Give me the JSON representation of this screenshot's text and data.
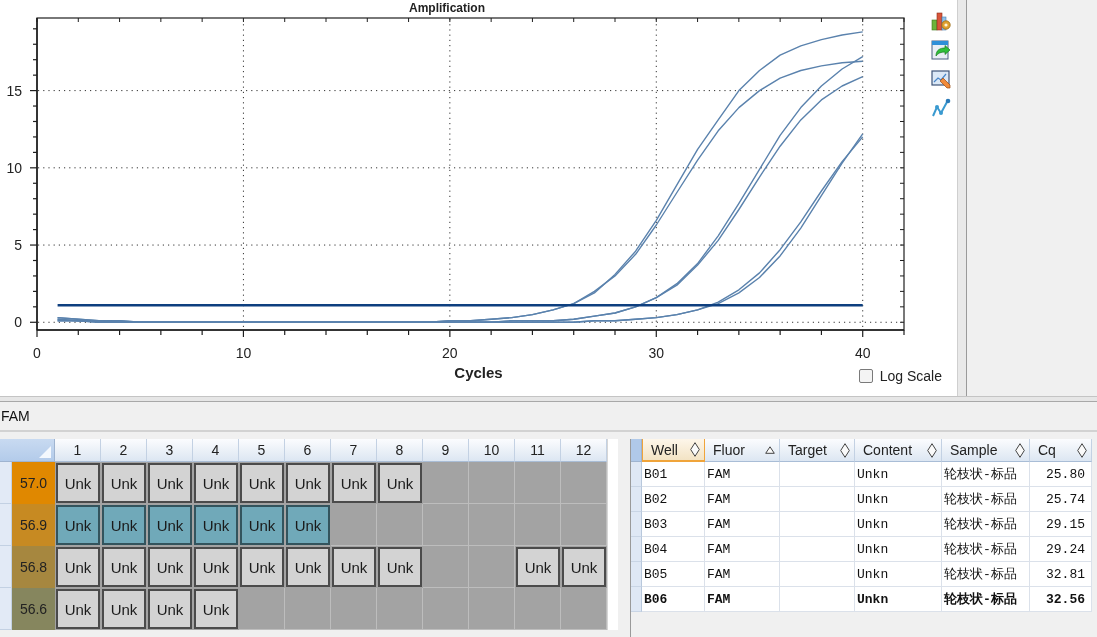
{
  "chart": {
    "chart_data": {
      "type": "line",
      "title": "Amplification",
      "xlabel": "Cycles",
      "x": [
        1,
        2,
        3,
        4,
        5,
        6,
        7,
        8,
        9,
        10,
        11,
        12,
        13,
        14,
        15,
        16,
        17,
        18,
        19,
        20,
        21,
        22,
        23,
        24,
        25,
        26,
        27,
        28,
        29,
        30,
        31,
        32,
        33,
        34,
        35,
        36,
        37,
        38,
        39,
        40
      ],
      "series": [
        {
          "color": "#5a82ad",
          "values": [
            0.3,
            0.2,
            0.1,
            0.1,
            0,
            0,
            0,
            0,
            0,
            0,
            0,
            0,
            0,
            0,
            0,
            0,
            0,
            0,
            0,
            0.1,
            0.1,
            0.2,
            0.3,
            0.5,
            0.8,
            1.2,
            1.9,
            3.1,
            4.6,
            6.6,
            8.9,
            11.2,
            13.1,
            15.0,
            16.3,
            17.3,
            17.9,
            18.3,
            18.6,
            18.8
          ]
        },
        {
          "color": "#5a82ad",
          "values": [
            0.3,
            0.2,
            0.1,
            0.1,
            0,
            0,
            0,
            0,
            0,
            0,
            0,
            0,
            0,
            0,
            0,
            0,
            0,
            0,
            0,
            0.1,
            0.1,
            0.2,
            0.3,
            0.5,
            0.8,
            1.2,
            2.0,
            3.0,
            4.4,
            6.3,
            8.4,
            10.5,
            12.4,
            13.9,
            15.0,
            15.8,
            16.3,
            16.6,
            16.8,
            16.9
          ]
        },
        {
          "color": "#5a82ad",
          "values": [
            0.2,
            0.1,
            0.1,
            0,
            0,
            0,
            0,
            0,
            0,
            0,
            0,
            0,
            0,
            0,
            0,
            0,
            0,
            0,
            0,
            0,
            0,
            0,
            0.1,
            0.1,
            0.1,
            0.2,
            0.4,
            0.6,
            1.0,
            1.6,
            2.5,
            3.8,
            5.6,
            7.7,
            9.9,
            12.1,
            13.9,
            15.3,
            16.4,
            17.2
          ]
        },
        {
          "color": "#5a82ad",
          "values": [
            0.2,
            0.1,
            0.1,
            0,
            0,
            0,
            0,
            0,
            0,
            0,
            0,
            0,
            0,
            0,
            0,
            0,
            0,
            0,
            0,
            0,
            0,
            0,
            0.1,
            0.1,
            0.1,
            0.2,
            0.4,
            0.6,
            1.0,
            1.6,
            2.4,
            3.7,
            5.3,
            7.3,
            9.4,
            11.4,
            13.1,
            14.4,
            15.3,
            15.9
          ]
        },
        {
          "color": "#5a82ad",
          "values": [
            0.1,
            0.1,
            0,
            0,
            0,
            0,
            0,
            0,
            0,
            0,
            0,
            0,
            0,
            0,
            0,
            0,
            0,
            0,
            0,
            0,
            0,
            0,
            0,
            0,
            0,
            0,
            0.1,
            0.1,
            0.2,
            0.3,
            0.5,
            0.8,
            1.2,
            1.9,
            2.9,
            4.3,
            6.1,
            8.2,
            10.3,
            12.2
          ]
        },
        {
          "color": "#5a82ad",
          "values": [
            0.1,
            0.1,
            0,
            0,
            0,
            0,
            0,
            0,
            0,
            0,
            0,
            0,
            0,
            0,
            0,
            0,
            0,
            0,
            0,
            0,
            0,
            0,
            0,
            0,
            0,
            0,
            0.1,
            0.1,
            0.2,
            0.3,
            0.5,
            0.8,
            1.3,
            2.1,
            3.2,
            4.7,
            6.5,
            8.5,
            10.4,
            12.0
          ]
        },
        {
          "color": "#0e3f7f",
          "values": [
            1.1,
            1.1,
            1.1,
            1.1,
            1.1,
            1.1,
            1.1,
            1.1,
            1.1,
            1.1,
            1.1,
            1.1,
            1.1,
            1.1,
            1.1,
            1.1,
            1.1,
            1.1,
            1.1,
            1.1,
            1.1,
            1.1,
            1.1,
            1.1,
            1.1,
            1.1,
            1.1,
            1.1,
            1.1,
            1.1,
            1.1,
            1.1,
            1.1,
            1.1,
            1.1,
            1.1,
            1.1,
            1.1,
            1.1,
            1.1
          ]
        }
      ],
      "xlim": [
        0,
        42
      ],
      "ylim": [
        -0.5,
        19.7
      ],
      "xticks": [
        0,
        10,
        20,
        30,
        40
      ],
      "yticks": [
        0,
        5,
        10,
        15
      ],
      "grid": true
    },
    "log_scale": {
      "label": "Log Scale",
      "checked": false
    }
  },
  "fluor_bar": {
    "label": "FAM"
  },
  "plate": {
    "columns": [
      "1",
      "2",
      "3",
      "4",
      "5",
      "6",
      "7",
      "8",
      "9",
      "10",
      "11",
      "12"
    ],
    "rows": [
      {
        "temperature": "57.0",
        "color": "#e08800",
        "wells": [
          {
            "kind": "sample",
            "label": "Unk",
            "selected": false
          },
          {
            "kind": "sample",
            "label": "Unk",
            "selected": false
          },
          {
            "kind": "sample",
            "label": "Unk",
            "selected": false
          },
          {
            "kind": "sample",
            "label": "Unk",
            "selected": false
          },
          {
            "kind": "sample",
            "label": "Unk",
            "selected": false
          },
          {
            "kind": "sample",
            "label": "Unk",
            "selected": false
          },
          {
            "kind": "sample",
            "label": "Unk",
            "selected": false
          },
          {
            "kind": "sample",
            "label": "Unk",
            "selected": false
          },
          {
            "kind": "empty",
            "selected": false
          },
          {
            "kind": "empty",
            "selected": false
          },
          {
            "kind": "empty",
            "selected": false
          },
          {
            "kind": "empty",
            "selected": false
          }
        ]
      },
      {
        "temperature": "56.9",
        "color": "#c78a22",
        "wells": [
          {
            "kind": "sample",
            "label": "Unk",
            "selected": true
          },
          {
            "kind": "sample",
            "label": "Unk",
            "selected": true
          },
          {
            "kind": "sample",
            "label": "Unk",
            "selected": true
          },
          {
            "kind": "sample",
            "label": "Unk",
            "selected": true
          },
          {
            "kind": "sample",
            "label": "Unk",
            "selected": true
          },
          {
            "kind": "sample",
            "label": "Unk",
            "selected": true
          },
          {
            "kind": "empty",
            "selected": false
          },
          {
            "kind": "empty",
            "selected": false
          },
          {
            "kind": "empty",
            "selected": false
          },
          {
            "kind": "empty",
            "selected": false
          },
          {
            "kind": "empty",
            "selected": false
          },
          {
            "kind": "empty",
            "selected": false
          }
        ]
      },
      {
        "temperature": "56.8",
        "color": "#a6873f",
        "wells": [
          {
            "kind": "sample",
            "label": "Unk",
            "selected": false
          },
          {
            "kind": "sample",
            "label": "Unk",
            "selected": false
          },
          {
            "kind": "sample",
            "label": "Unk",
            "selected": false
          },
          {
            "kind": "sample",
            "label": "Unk",
            "selected": false
          },
          {
            "kind": "sample",
            "label": "Unk",
            "selected": false
          },
          {
            "kind": "sample",
            "label": "Unk",
            "selected": false
          },
          {
            "kind": "sample",
            "label": "Unk",
            "selected": false
          },
          {
            "kind": "sample",
            "label": "Unk",
            "selected": false
          },
          {
            "kind": "empty",
            "selected": false
          },
          {
            "kind": "empty",
            "selected": false
          },
          {
            "kind": "sample",
            "label": "Unk",
            "selected": false
          },
          {
            "kind": "sample",
            "label": "Unk",
            "selected": false
          }
        ]
      },
      {
        "temperature": "56.6",
        "color": "#86865e",
        "wells": [
          {
            "kind": "sample",
            "label": "Unk",
            "selected": false
          },
          {
            "kind": "sample",
            "label": "Unk",
            "selected": false
          },
          {
            "kind": "sample",
            "label": "Unk",
            "selected": false
          },
          {
            "kind": "sample",
            "label": "Unk",
            "selected": false
          },
          {
            "kind": "empty",
            "selected": false
          },
          {
            "kind": "empty",
            "selected": false
          },
          {
            "kind": "empty",
            "selected": false
          },
          {
            "kind": "empty",
            "selected": false
          },
          {
            "kind": "empty",
            "selected": false
          },
          {
            "kind": "empty",
            "selected": false
          },
          {
            "kind": "empty",
            "selected": false
          },
          {
            "kind": "empty",
            "selected": false
          }
        ]
      }
    ]
  },
  "results": {
    "columns": [
      {
        "label": "Well",
        "sorted": false,
        "highlighted": true
      },
      {
        "label": "Fluor",
        "sorted": true,
        "highlighted": false
      },
      {
        "label": "Target",
        "sorted": false,
        "highlighted": false
      },
      {
        "label": "Content",
        "sorted": false,
        "highlighted": false
      },
      {
        "label": "Sample",
        "sorted": false,
        "highlighted": false
      },
      {
        "label": "Cq",
        "sorted": false,
        "highlighted": false
      }
    ],
    "rows": [
      {
        "well": "B01",
        "fluor": "FAM",
        "content": "Unkn",
        "sample": "轮枝状-标品",
        "cq": "25.80",
        "current": false
      },
      {
        "well": "B02",
        "fluor": "FAM",
        "content": "Unkn",
        "sample": "轮枝状-标品",
        "cq": "25.74",
        "current": false
      },
      {
        "well": "B03",
        "fluor": "FAM",
        "content": "Unkn",
        "sample": "轮枝状-标品",
        "cq": "29.15",
        "current": false
      },
      {
        "well": "B04",
        "fluor": "FAM",
        "content": "Unkn",
        "sample": "轮枝状-标品",
        "cq": "29.24",
        "current": false
      },
      {
        "well": "B05",
        "fluor": "FAM",
        "content": "Unkn",
        "sample": "轮枝状-标品",
        "cq": "32.81",
        "current": false
      },
      {
        "well": "B06",
        "fluor": "FAM",
        "content": "Unkn",
        "sample": "轮枝状-标品",
        "cq": "32.56",
        "current": true
      }
    ]
  }
}
